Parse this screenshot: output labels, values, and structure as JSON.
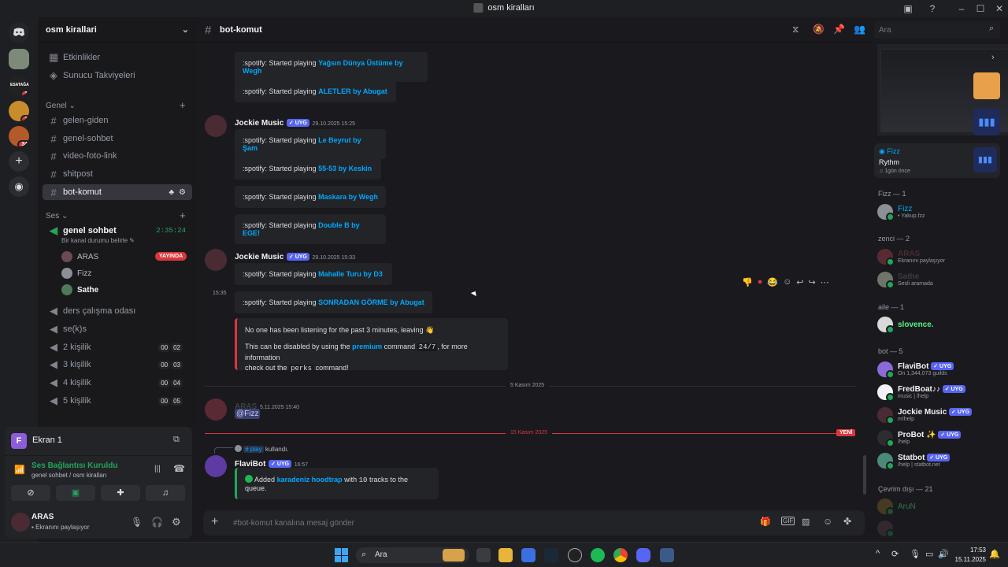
{
  "window": {
    "title": "osm kiralları"
  },
  "servers": [
    {
      "badge": ""
    },
    {
      "badge": "1"
    },
    {
      "badge": "2"
    },
    {
      "badge": "34"
    }
  ],
  "guild": {
    "name": "osm kirallari"
  },
  "sidebar": {
    "top_items": [
      "Etkinlikler",
      "Sunucu Takviyeleri"
    ],
    "category_general": "Genel",
    "text_channels": [
      "gelen-giden",
      "genel-sohbet",
      "video-foto-link",
      "shitpost",
      "bot-komut"
    ],
    "category_voice": "Ses",
    "voice_main": {
      "name": "genel sohbet",
      "timer": "2:35:24",
      "status": "Bir kanal durumu belirle"
    },
    "voice_users": [
      {
        "name": "ARAS",
        "badge": "YAYINDA"
      },
      {
        "name": "Fizz",
        "badge": ""
      },
      {
        "name": "Sathe",
        "badge": ""
      }
    ],
    "voice_channels": [
      {
        "name": "ders çalışma odası",
        "c1": "",
        "c2": ""
      },
      {
        "name": "se(k)s",
        "c1": "",
        "c2": ""
      },
      {
        "name": "2 kişilik",
        "c1": "00",
        "c2": "02"
      },
      {
        "name": "3 kişilik",
        "c1": "00",
        "c2": "03"
      },
      {
        "name": "4 kişilik",
        "c1": "00",
        "c2": "04"
      },
      {
        "name": "5 kişilik",
        "c1": "00",
        "c2": "05"
      }
    ]
  },
  "panel": {
    "screen_label": "Ekran 1",
    "screen_letter": "F",
    "voice_status": "Ses Bağlantısı Kuruldu",
    "voice_location": "genel sohbet / osm kiralları",
    "user_name": "ARAS",
    "user_status": "Ekranını paylaşıyor"
  },
  "channel": {
    "name": "bot-komut",
    "composer_placeholder": "#bot-komut kanalına mesaj gönder",
    "search_placeholder": "Ara"
  },
  "messages": {
    "embed_prefix": ":spotify:  Started playing",
    "top_embeds": [
      "Yağsın Dünya Üstüme by Wegh",
      "ALETLER by Abugat"
    ],
    "group1": {
      "author": "Jockie Music",
      "tag": "UYG",
      "time": "29.10.2025 15:25",
      "songs": [
        "Le Beyrut by Şam",
        "55-53 by Keskin",
        "Maskara by Wegh",
        "Double B by EGE!"
      ]
    },
    "group2": {
      "author": "Jockie Music",
      "tag": "UYG",
      "time": "29.10.2025 15:33",
      "songs": [
        "Mahalle Turu by D3",
        "SONRADAN GÖRME by Abugat"
      ],
      "side_time": "15:35",
      "notice_line1": "No one has been listening for the past 3 minutes, leaving 👋",
      "notice_line2a": "This can be disabled by using the",
      "notice_premium": "premium",
      "notice_line2b": "command",
      "notice_code": "24/7",
      "notice_line2c": ", for more information",
      "notice_line3a": "check out the",
      "notice_perks": "perks",
      "notice_line3b": "command!"
    },
    "date_divider_1": "5 Kasım 2025",
    "group3": {
      "author": "ARAS",
      "time": "5.11.2025 15:40",
      "mention": "@Fizz"
    },
    "date_divider_2": "15 Kasım 2025",
    "new_badge": "YENİ",
    "group4": {
      "reply_channel": "# play",
      "reply_text": "kullandı.",
      "author": "FlaviBot",
      "tag": "UYG",
      "time": "16:57",
      "added_prefix": "Added",
      "playlist": "karadeniz hoodtrap",
      "added_mid": "with",
      "count": "10",
      "added_suffix": "tracks to the queue."
    }
  },
  "members": {
    "activity_card": {
      "user": "Fizz",
      "app": "Rythm",
      "time": "1gün önce"
    },
    "groups": [
      {
        "title": "Fizz — 1",
        "members": [
          {
            "name": "Fizz",
            "sub": "• Yakup.fzz",
            "color": "#00a8fc",
            "tag": ""
          }
        ]
      },
      {
        "title": "zenci — 2",
        "members": [
          {
            "name": "ARAS",
            "sub": "Ekranını paylaşıyor",
            "color": "#4a2b33",
            "tag": ""
          },
          {
            "name": "Sathe",
            "sub": "Sesli aramada",
            "color": "#3a3c43",
            "tag": ""
          }
        ]
      },
      {
        "title": "aile — 1",
        "members": [
          {
            "name": "slovence.",
            "sub": "",
            "color": "#57f287",
            "tag": ""
          }
        ]
      },
      {
        "title": "bot — 5",
        "members": [
          {
            "name": "FlaviBot",
            "sub": "On 1,344,073 guilds",
            "color": "#f2f3f5",
            "tag": "UYG"
          },
          {
            "name": "FredBoat♪♪",
            "sub": "music | /help",
            "color": "#f2f3f5",
            "tag": "UYG"
          },
          {
            "name": "Jockie Music",
            "sub": "m!help",
            "color": "#f2f3f5",
            "tag": "UYG"
          },
          {
            "name": "ProBot ✨",
            "sub": "/help",
            "color": "#f2f3f5",
            "tag": "UYG"
          },
          {
            "name": "Statbot",
            "sub": "/help | statbot.net",
            "color": "#f2f3f5",
            "tag": "UYG"
          }
        ]
      },
      {
        "title": "Çevrim dışı — 21",
        "members": [
          {
            "name": "AruN",
            "sub": "",
            "color": "#2f6b3f",
            "tag": ""
          }
        ]
      }
    ]
  },
  "taskbar": {
    "search": "Ara",
    "time": "17:53",
    "date": "15.11.2025"
  }
}
